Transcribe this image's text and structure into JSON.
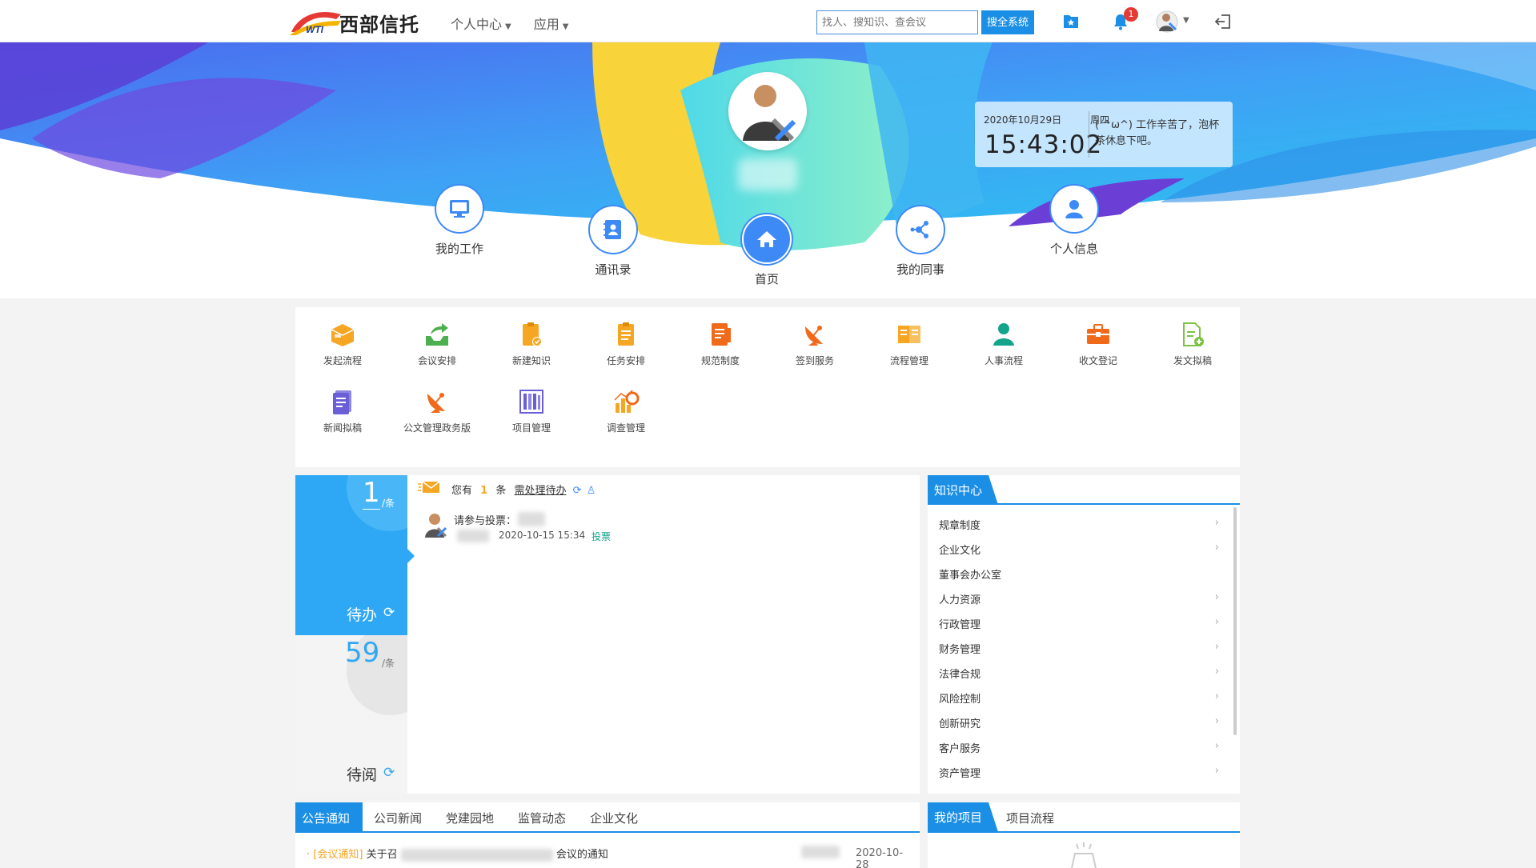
{
  "header": {
    "logo_text": "西部信托",
    "logo_mark": "WTI",
    "menu": [
      {
        "label": "个人中心"
      },
      {
        "label": "应用"
      }
    ],
    "search_placeholder": "找人、搜知识、查会议",
    "search_button": "搜全系统",
    "notification_count": "1"
  },
  "clock": {
    "date": "2020年10月29日",
    "weekday": "周四",
    "time": "15:43:02",
    "message": "( ^ω^) 工作辛苦了，泡杯茶休息下吧。"
  },
  "nav": {
    "my_work": "我的工作",
    "contacts": "通讯录",
    "home": "首页",
    "colleagues": "我的同事",
    "profile": "个人信息"
  },
  "apps": [
    "发起流程",
    "会议安排",
    "新建知识",
    "任务安排",
    "规范制度",
    "签到服务",
    "流程管理",
    "人事流程",
    "收文登记",
    "发文拟稿",
    "新闻拟稿",
    "公文管理政务版",
    "项目管理",
    "调查管理"
  ],
  "todo": {
    "pending_count": "1",
    "pending_unit": "/条",
    "pending_label": "待办",
    "read_count": "59",
    "read_unit": "/条",
    "read_label": "待阅",
    "summary_prefix": "您有",
    "summary_count": "1",
    "summary_mid": "条",
    "summary_link": "需处理待办",
    "item_title": "请参与投票：",
    "item_time": "2020-10-15 15:34",
    "item_tag": "投票"
  },
  "knowledge": {
    "title": "知识中心",
    "items": [
      {
        "label": "规章制度",
        "arrow": "›"
      },
      {
        "label": "企业文化",
        "arrow": "›"
      },
      {
        "label": "董事会办公室",
        "arrow": ""
      },
      {
        "label": "人力资源",
        "arrow": "›"
      },
      {
        "label": "行政管理",
        "arrow": "›"
      },
      {
        "label": "财务管理",
        "arrow": "›"
      },
      {
        "label": "法律合规",
        "arrow": "›"
      },
      {
        "label": "风险控制",
        "arrow": "›"
      },
      {
        "label": "创新研究",
        "arrow": "›"
      },
      {
        "label": "客户服务",
        "arrow": "›"
      },
      {
        "label": "资产管理",
        "arrow": "›"
      }
    ]
  },
  "notice": {
    "tabs": [
      "公告通知",
      "公司新闻",
      "党建园地",
      "监管动态",
      "企业文化"
    ],
    "item_tag": "[会议通知]",
    "item_prefix": "关于召",
    "item_suffix": "会议的通知",
    "item_date": "2020-10-28"
  },
  "projects": {
    "tabs": [
      "我的项目",
      "项目流程"
    ]
  },
  "colors": {
    "primary": "#1b8fe6",
    "accent_blue": "#3d8af7",
    "todo_blue": "#2ea8f5",
    "badge_red": "#e53935"
  }
}
